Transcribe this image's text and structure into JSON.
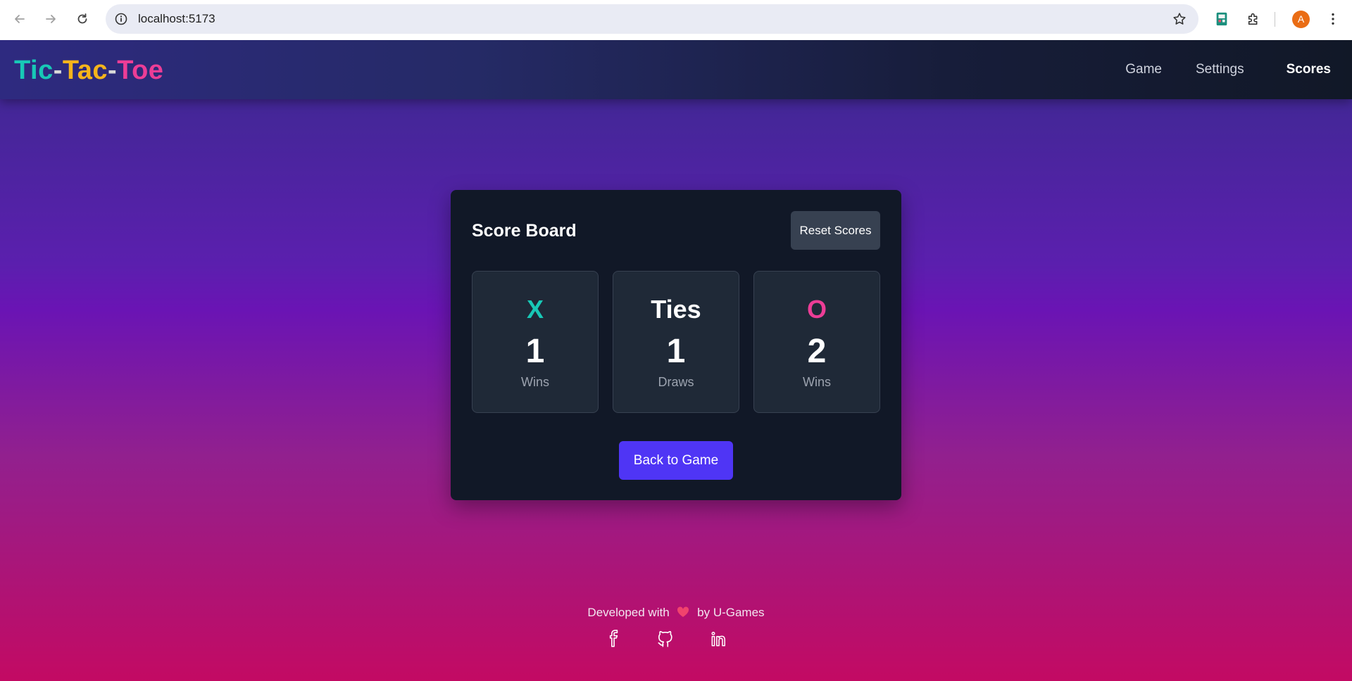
{
  "browser": {
    "url": "localhost:5173",
    "profile_initial": "A",
    "icons": [
      "back-arrow-icon",
      "forward-arrow-icon",
      "reload-icon",
      "info-icon",
      "star-icon",
      "extension-app-icon",
      "puzzle-icon",
      "kebab-menu-icon"
    ]
  },
  "navbar": {
    "brand": {
      "part1": "Tic",
      "sep1": "-",
      "part2": "Tac",
      "sep2": "-",
      "part3": "Toe"
    },
    "links": [
      {
        "label": "Game",
        "active": false
      },
      {
        "label": "Settings",
        "active": false
      },
      {
        "label": "Scores",
        "active": true
      }
    ]
  },
  "scoreboard": {
    "title": "Score Board",
    "reset_label": "Reset Scores",
    "tiles": [
      {
        "head": "X",
        "count": "1",
        "sub": "Wins",
        "color": "#18c8b6"
      },
      {
        "head": "Ties",
        "count": "1",
        "sub": "Draws",
        "color": "#ffffff"
      },
      {
        "head": "O",
        "count": "2",
        "sub": "Wins",
        "color": "#ec3d96"
      }
    ],
    "back_label": "Back to Game"
  },
  "footer": {
    "text_before": "Developed with",
    "text_after": "by U-Games",
    "heart_icon": "heart-icon",
    "socials": [
      "facebook-icon",
      "github-icon",
      "linkedin-icon"
    ]
  },
  "colors": {
    "accent_button": "#4f35f5",
    "card_bg": "#111827",
    "tile_bg": "#1f2937"
  }
}
